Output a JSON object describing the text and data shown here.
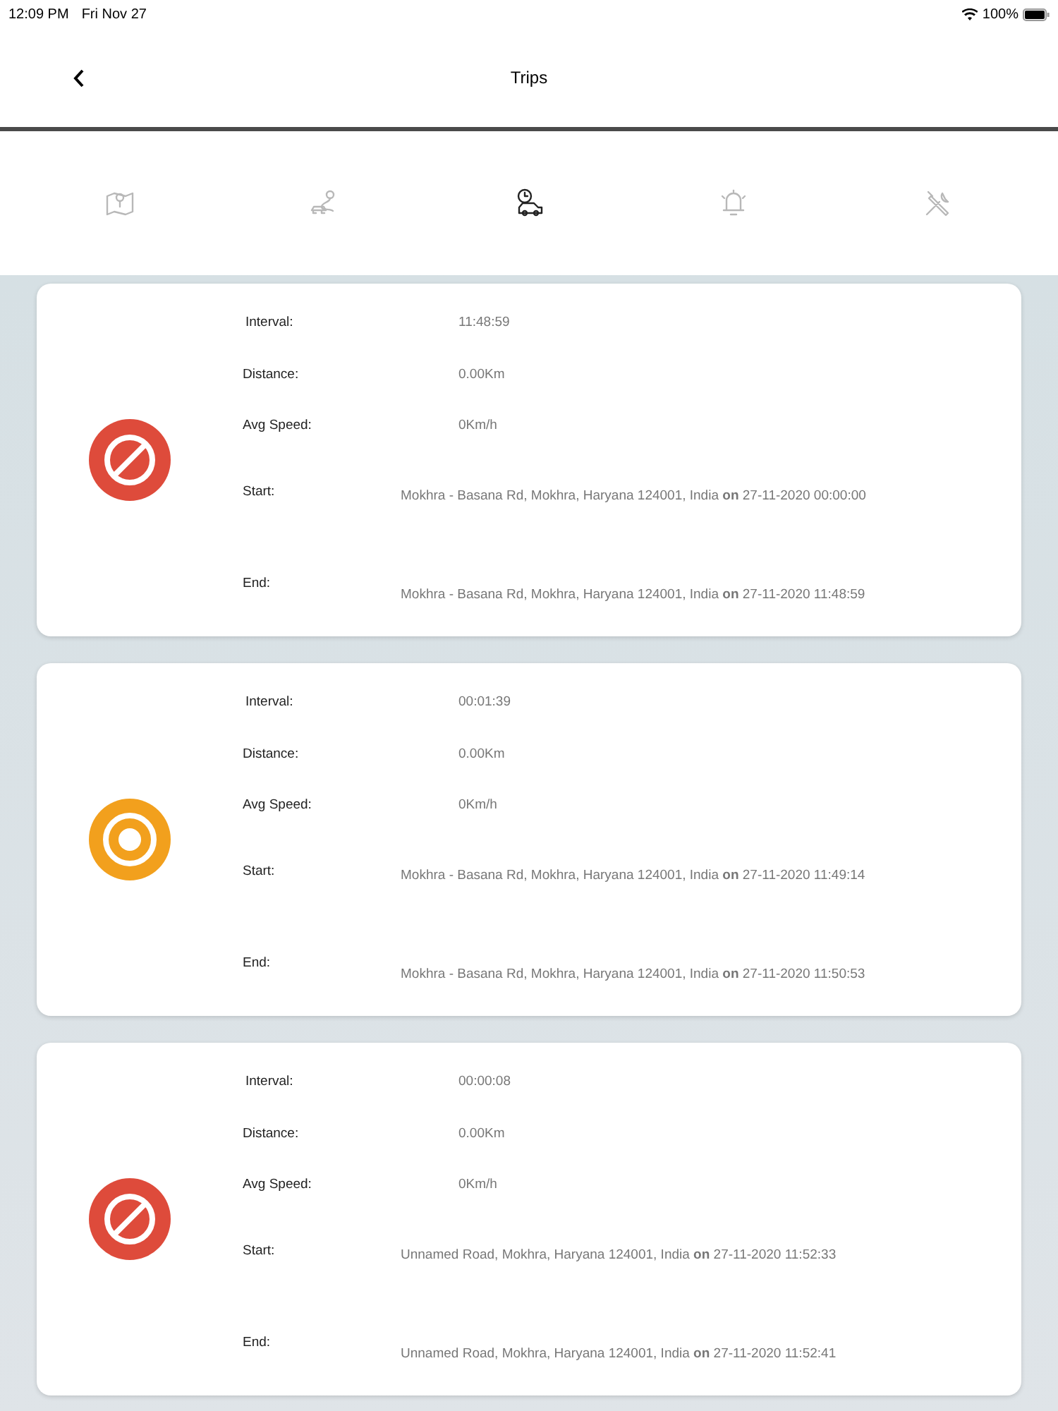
{
  "status_bar": {
    "time": "12:09 PM",
    "date": "Fri Nov 27",
    "battery": "100%"
  },
  "header": {
    "title": "Trips"
  },
  "tabs": [
    {
      "kind": "map",
      "selected": false
    },
    {
      "kind": "route",
      "selected": false
    },
    {
      "kind": "trip",
      "selected": true
    },
    {
      "kind": "alarm",
      "selected": false
    },
    {
      "kind": "tools",
      "selected": false
    }
  ],
  "trips": [
    {
      "kind": "stopped",
      "interval_label": "Interval:",
      "interval": "11:48:59",
      "distance_label": "Distance:",
      "distance": "0.00Km",
      "speed_label": "Avg Speed:",
      "speed": "0Km/h",
      "start_label": "Start:",
      "start": "Mokhra - Basana Rd, Mokhra, Haryana 124001, India **on** 27-11-2020 00:00:00",
      "end_label": "End:",
      "end": "Mokhra - Basana Rd, Mokhra, Haryana 124001, India **on** 27-11-2020 11:48:59"
    },
    {
      "kind": "idle",
      "interval_label": "Interval:",
      "interval": "00:01:39",
      "distance_label": "Distance:",
      "distance": "0.00Km",
      "speed_label": "Avg Speed:",
      "speed": "0Km/h",
      "start_label": "Start:",
      "start": "Mokhra - Basana Rd, Mokhra, Haryana 124001, India **on** 27-11-2020 11:49:14",
      "end_label": "End:",
      "end": "Mokhra - Basana Rd, Mokhra, Haryana 124001, India **on** 27-11-2020 11:50:53"
    },
    {
      "kind": "stopped",
      "interval_label": "Interval:",
      "interval": "00:00:08",
      "distance_label": "Distance:",
      "distance": "0.00Km",
      "speed_label": "Avg Speed:",
      "speed": "0Km/h",
      "start_label": "Start:",
      "start": "Unnamed Road, Mokhra, Haryana 124001, India **on** 27-11-2020 11:52:33",
      "end_label": "End:",
      "end": "Unnamed Road, Mokhra, Haryana 124001, India **on** 27-11-2020 11:52:41"
    }
  ]
}
